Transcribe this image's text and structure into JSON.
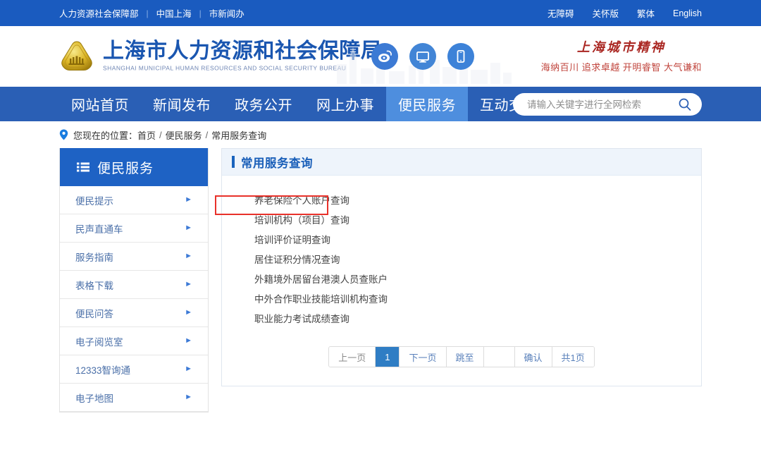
{
  "topbar": {
    "left_links": [
      "人力资源社会保障部",
      "中国上海",
      "市新闻办"
    ],
    "separator": "|",
    "right_links": [
      "无障碍",
      "关怀版",
      "繁体",
      "English"
    ]
  },
  "header": {
    "site_title": "上海市人力资源和社会保障局",
    "site_subtitle": "SHANGHAI MUNICIPAL HUMAN RESOURCES AND SOCIAL SECURITY BUREAU",
    "emblem_name": "shanghai-hrss-emblem",
    "quick_icons": [
      {
        "name": "weibo-icon"
      },
      {
        "name": "desktop-monitor-icon"
      },
      {
        "name": "mobile-phone-icon"
      }
    ],
    "spirit_title": "上海城市精神",
    "spirit_subtitle": "海纳百川 追求卓越 开明睿智 大气谦和",
    "spirit_color": "#b92e2a"
  },
  "nav": {
    "items": [
      {
        "label": "网站首页",
        "active": false
      },
      {
        "label": "新闻发布",
        "active": false
      },
      {
        "label": "政务公开",
        "active": false
      },
      {
        "label": "网上办事",
        "active": false
      },
      {
        "label": "便民服务",
        "active": true
      },
      {
        "label": "互动交流",
        "active": false
      }
    ],
    "active_color": "#4e8ede",
    "bar_color": "#2a5fb5"
  },
  "search": {
    "value": "",
    "placeholder": "请输入关键字进行全网检索",
    "icon": "search-icon"
  },
  "breadcrumb": {
    "icon": "location-pin-icon",
    "prefix": "您现在的位置：",
    "items": [
      "首页",
      "便民服务",
      "常用服务查询"
    ],
    "separator": "/"
  },
  "sidebar": {
    "title": "便民服务",
    "icon": "list-menu-icon",
    "items": [
      {
        "label": "便民提示"
      },
      {
        "label": "民声直通车"
      },
      {
        "label": "服务指南"
      },
      {
        "label": "表格下载"
      },
      {
        "label": "便民问答"
      },
      {
        "label": "电子阅览室"
      },
      {
        "label": "12333智询通"
      },
      {
        "label": "电子地图"
      }
    ],
    "arrow": "►"
  },
  "content": {
    "title": "常用服务查询",
    "links": [
      {
        "label": "养老保险个人账户查询",
        "highlighted": false
      },
      {
        "label": "培训机构（项目）查询",
        "highlighted": true
      },
      {
        "label": "培训评价证明查询",
        "highlighted": false
      },
      {
        "label": "居住证积分情况查询",
        "highlighted": false
      },
      {
        "label": "外籍境外居留台港澳人员查账户",
        "highlighted": false
      },
      {
        "label": "中外合作职业技能培训机构查询",
        "highlighted": false
      },
      {
        "label": "职业能力考试成绩查询",
        "highlighted": false
      }
    ],
    "highlight_color": "#e8312a"
  },
  "pagination": {
    "prev_label": "上一页",
    "current_page": "1",
    "next_label": "下一页",
    "jump_label": "跳至",
    "jump_value": "",
    "confirm_label": "确认",
    "total_label": "共1页",
    "active_color": "#2f7dc4"
  }
}
